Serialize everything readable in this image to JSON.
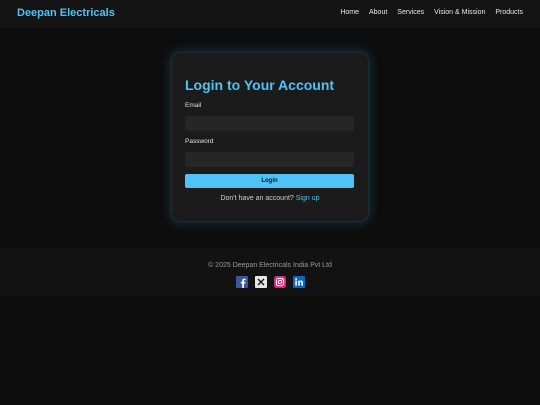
{
  "header": {
    "brand": "Deepan Electricals",
    "nav": [
      "Home",
      "About",
      "Services",
      "Vision & Mission",
      "Products"
    ]
  },
  "login": {
    "title": "Login to Your Account",
    "email_label": "Email",
    "email_value": "",
    "password_label": "Password",
    "password_value": "",
    "submit_label": "Login",
    "signup_prompt": "Don't have an account?",
    "signup_link": "Sign up"
  },
  "footer": {
    "copyright": "© 2025 Deepan Electricals India Pvt Ltd",
    "socials": [
      "facebook-icon",
      "x-icon",
      "instagram-icon",
      "linkedin-icon"
    ]
  },
  "colors": {
    "accent": "#4fc3f7",
    "background": "#0d0d0d",
    "card": "#1b1b1b"
  }
}
